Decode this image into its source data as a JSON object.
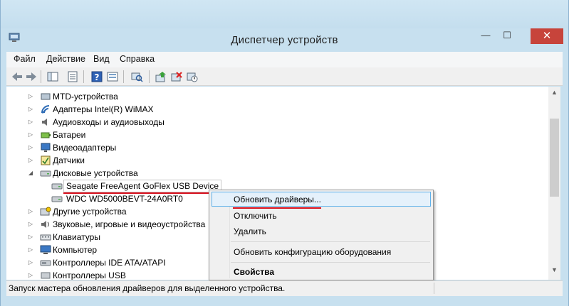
{
  "window": {
    "title": "Диспетчер устройств",
    "minimize_glyph": "—",
    "maximize_glyph": "☐",
    "close_glyph": "✕"
  },
  "menu": {
    "items": [
      "Файл",
      "Действие",
      "Вид",
      "Справка"
    ]
  },
  "toolbar": {
    "buttons": [
      "back-arrow-icon",
      "forward-arrow-icon",
      "console-tree-icon",
      "properties-icon",
      "help-icon",
      "show-hidden-icon",
      "update-driver-icon",
      "uninstall-device-icon",
      "scan-hardware-icon"
    ]
  },
  "tree": {
    "items": [
      {
        "label": "MTD-устройства",
        "expander": "▷",
        "icon": "mtd-icon"
      },
      {
        "label": "Адаптеры Intel(R) WiMAX",
        "expander": "▷",
        "icon": "wimax-icon"
      },
      {
        "label": "Аудиовходы и аудиовыходы",
        "expander": "▷",
        "icon": "speaker-icon"
      },
      {
        "label": "Батареи",
        "expander": "▷",
        "icon": "battery-icon"
      },
      {
        "label": "Видеоадаптеры",
        "expander": "▷",
        "icon": "display-adapter-icon"
      },
      {
        "label": "Датчики",
        "expander": "▷",
        "icon": "sensor-icon"
      },
      {
        "label": "Дисковые устройства",
        "expander": "◢",
        "icon": "disk-drive-icon"
      },
      {
        "label": "Seagate FreeAgent GoFlex USB Device",
        "expander": "",
        "icon": "disk-drive-icon"
      },
      {
        "label": "WDC WD5000BEVT-24A0RT0",
        "expander": "",
        "icon": "disk-drive-icon"
      },
      {
        "label": "Другие устройства",
        "expander": "▷",
        "icon": "unknown-device-icon"
      },
      {
        "label": "Звуковые, игровые и видеоустройства",
        "expander": "▷",
        "icon": "sound-icon"
      },
      {
        "label": "Клавиатуры",
        "expander": "▷",
        "icon": "keyboard-icon"
      },
      {
        "label": "Компьютер",
        "expander": "▷",
        "icon": "computer-icon"
      },
      {
        "label": "Контроллеры IDE ATA/ATAPI",
        "expander": "▷",
        "icon": "ide-controller-icon"
      },
      {
        "label": "Контроллеры USB",
        "expander": "▷",
        "icon": "usb-controller-icon"
      }
    ]
  },
  "context_menu": {
    "items": [
      "Обновить драйверы...",
      "Отключить",
      "Удалить",
      "Обновить конфигурацию оборудования",
      "Свойства"
    ]
  },
  "scrollbar": {
    "up_glyph": "▲",
    "down_glyph": "▼"
  },
  "status": {
    "text": "Запуск мастера обновления драйверов для выделенного устройства."
  },
  "colors": {
    "accent_underline": "#d80f1c",
    "close_button": "#c7443b",
    "menu_highlight_border": "#5fb1ea"
  }
}
